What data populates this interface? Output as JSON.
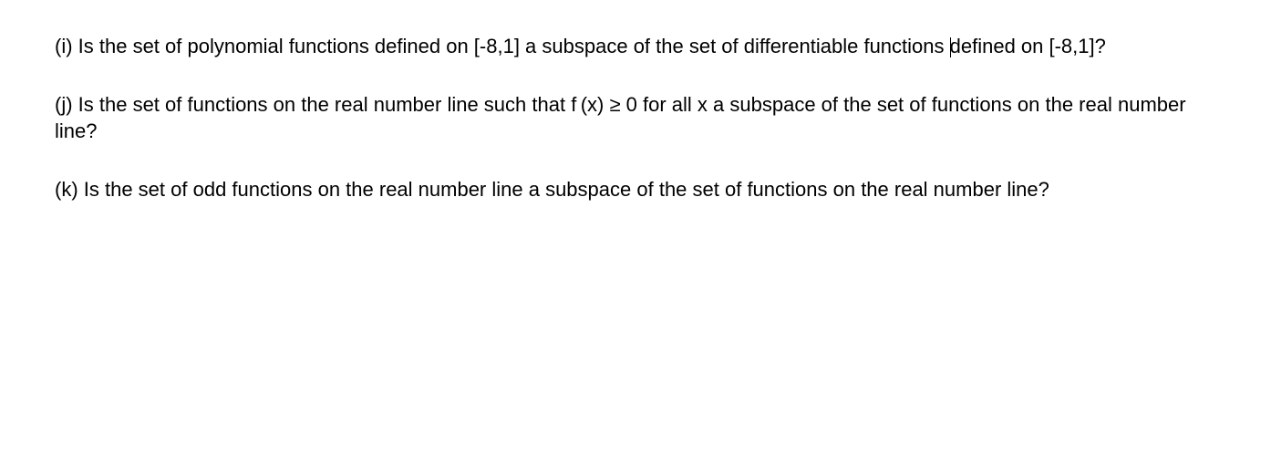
{
  "questions": {
    "i": {
      "part1": "(i) Is the set of polynomial functions defined on [-8,1] a subspace of the set of differentiable functions ",
      "part2": "defined on [-8,1]?"
    },
    "j": "(j) Is the set of functions on the real number line such that f (x) ≥ 0 for all x a subspace of the set of functions on the real number line?",
    "k": "(k) Is the set of odd functions on the real number line a subspace of the set of functions on the real number line?"
  }
}
